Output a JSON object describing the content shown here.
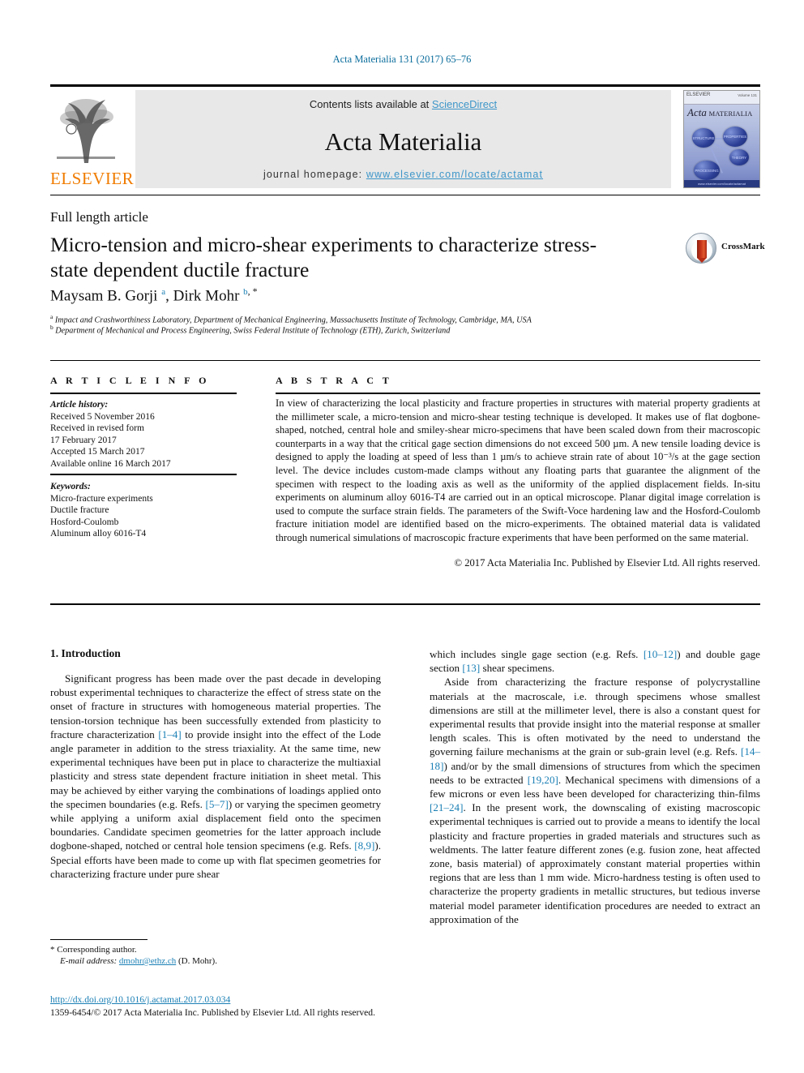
{
  "running_head": "Acta Materialia 131 (2017) 65–76",
  "masthead": {
    "contents_text": "Contents lists available at ",
    "sciencedirect": "ScienceDirect",
    "journal_name": "Acta Materialia",
    "homepage_label": "journal homepage: ",
    "homepage_url": "www.elsevier.com/locate/actamat",
    "publisher_wordmark": "ELSEVIER",
    "accent_link_color": "#3d96c9",
    "publisher_color": "#f07c00"
  },
  "cover": {
    "publisher_mark": "ELSEVIER",
    "issue_line": "Volume 131",
    "title_big": "Acta",
    "title_small": "MATERIALIA",
    "nodes": [
      "STRUCTURE",
      "PROPERTIES",
      "THEORY",
      "PROCESSING"
    ],
    "footer": "www.elsevier.com/locate/actamat"
  },
  "article": {
    "type": "Full length article",
    "title": "Micro-tension and micro-shear experiments to characterize stress-state dependent ductile fracture",
    "crossmark_label": "CrossMark",
    "authors_html": "Maysam B. Gorji <sup class=\"sup\">a</sup>, Dirk Mohr <sup class=\"sup\">b</sup><sup class=\"sup-star\">, *</sup>",
    "affiliation_a": "Impact and Crashworthiness Laboratory, Department of Mechanical Engineering, Massachusetts Institute of Technology, Cambridge, MA, USA",
    "affiliation_b": "Department of Mechanical and Process Engineering, Swiss Federal Institute of Technology (ETH), Zurich, Switzerland"
  },
  "info": {
    "heading": "A R T I C L E  I N F O",
    "history_label": "Article history:",
    "history": [
      "Received 5 November 2016",
      "Received in revised form",
      "17 February 2017",
      "Accepted 15 March 2017",
      "Available online 16 March 2017"
    ],
    "keywords_label": "Keywords:",
    "keywords": [
      "Micro-fracture experiments",
      "Ductile fracture",
      "Hosford-Coulomb",
      "Aluminum alloy 6016-T4"
    ]
  },
  "abstract": {
    "heading": "A B S T R A C T",
    "body": "In view of characterizing the local plasticity and fracture properties in structures with material property gradients at the millimeter scale, a micro-tension and micro-shear testing technique is developed. It makes use of flat dogbone-shaped, notched, central hole and smiley-shear micro-specimens that have been scaled down from their macroscopic counterparts in a way that the critical gage section dimensions do not exceed 500 µm. A new tensile loading device is designed to apply the loading at speed of less than 1 µm/s to achieve strain rate of about 10⁻³/s at the gage section level. The device includes custom-made clamps without any floating parts that guarantee the alignment of the specimen with respect to the loading axis as well as the uniformity of the applied displacement fields. In-situ experiments on aluminum alloy 6016-T4 are carried out in an optical microscope. Planar digital image correlation is used to compute the surface strain fields. The parameters of the Swift-Voce hardening law and the Hosford-Coulomb fracture initiation model are identified based on the micro-experiments. The obtained material data is validated through numerical simulations of macroscopic fracture experiments that have been performed on the same material.",
    "copyright": "© 2017 Acta Materialia Inc. Published by Elsevier Ltd. All rights reserved."
  },
  "body": {
    "section_number_title": "1. Introduction",
    "left_paragraphs": [
      "Significant progress has been made over the past decade in developing robust experimental techniques to characterize the effect of stress state on the onset of fracture in structures with homogeneous material properties. The tension-torsion technique has been successfully extended from plasticity to fracture characterization [1–4] to provide insight into the effect of the Lode angle parameter in addition to the stress triaxiality. At the same time, new experimental techniques have been put in place to characterize the multiaxial plasticity and stress state dependent fracture initiation in sheet metal. This may be achieved by either varying the combinations of loadings applied onto the specimen boundaries (e.g. Refs. [5–7]) or varying the specimen geometry while applying a uniform axial displacement field onto the specimen boundaries. Candidate specimen geometries for the latter approach include dogbone-shaped, notched or central hole tension specimens (e.g. Refs. [8,9]). Special efforts have been made to come up with flat specimen geometries for characterizing fracture under pure shear"
    ],
    "right_paragraphs": [
      "which includes single gage section (e.g. Refs. [10–12]) and double gage section [13] shear specimens.",
      "Aside from characterizing the fracture response of polycrystalline materials at the macroscale, i.e. through specimens whose smallest dimensions are still at the millimeter level, there is also a constant quest for experimental results that provide insight into the material response at smaller length scales. This is often motivated by the need to understand the governing failure mechanisms at the grain or sub-grain level (e.g. Refs. [14–18]) and/or by the small dimensions of structures from which the specimen needs to be extracted [19,20]. Mechanical specimens with dimensions of a few microns or even less have been developed for characterizing thin-films [21–24]. In the present work, the downscaling of existing macroscopic experimental techniques is carried out to provide a means to identify the local plasticity and fracture properties in graded materials and structures such as weldments. The latter feature different zones (e.g. fusion zone, heat affected zone, basis material) of approximately constant material properties within regions that are less than 1 mm wide. Micro-hardness testing is often used to characterize the property gradients in metallic structures, but tedious inverse material model parameter identification procedures are needed to extract an approximation of the"
    ],
    "reference_color": "#1a7fb5"
  },
  "footer": {
    "corresponding_star": "*",
    "corresponding_text": "Corresponding author.",
    "email_label": "E-mail address:",
    "email": "dmohr@ethz.ch",
    "email_suffix": "(D. Mohr).",
    "doi": "http://dx.doi.org/10.1016/j.actamat.2017.03.034",
    "copyright_line": "1359-6454/© 2017 Acta Materialia Inc. Published by Elsevier Ltd. All rights reserved."
  }
}
